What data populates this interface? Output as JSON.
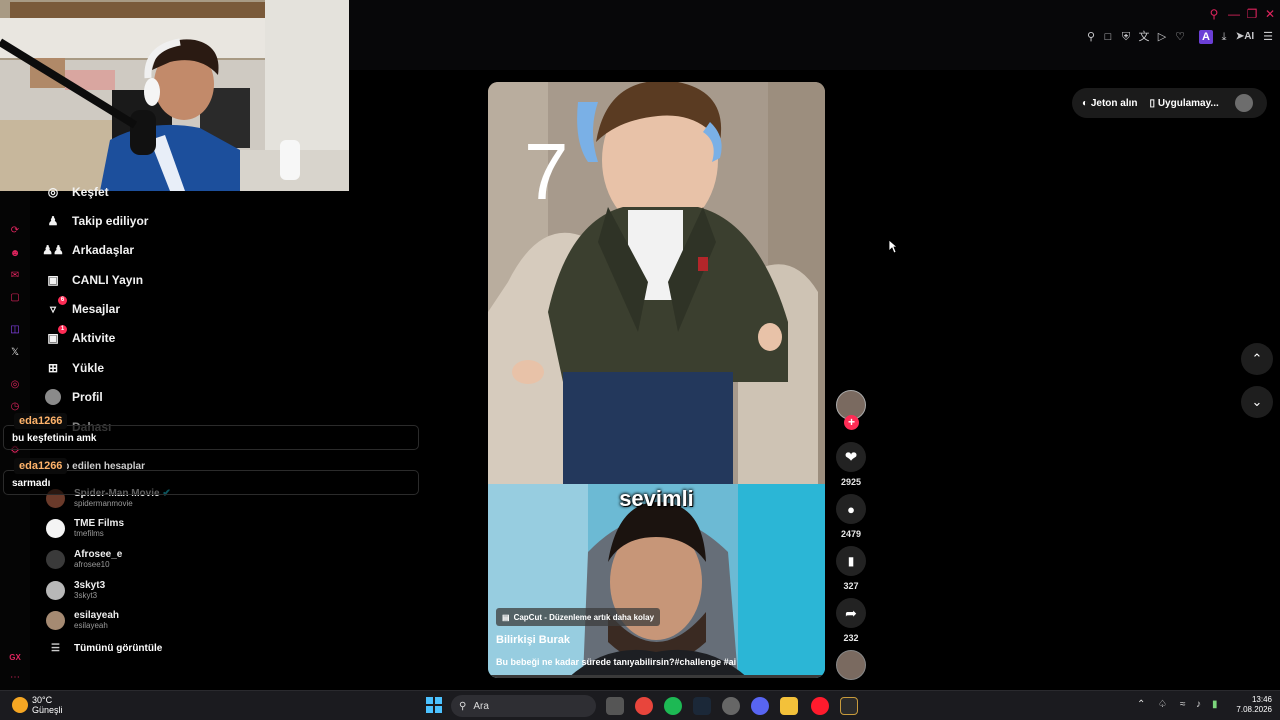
{
  "browser": {
    "toolbar_icons": [
      "pin-icon",
      "snapshot-icon",
      "shield-icon",
      "translate-icon",
      "play-icon",
      "heart-icon",
      "extension-icon",
      "download-icon",
      "ai-icon",
      "menu-icon"
    ],
    "ai_label": "AI"
  },
  "header": {
    "coins_label": "Jeton alın",
    "app_label": "Uygulamay..."
  },
  "sidebar": {
    "items": [
      {
        "label": "Keşfet"
      },
      {
        "label": "Takip ediliyor"
      },
      {
        "label": "Arkadaşlar"
      },
      {
        "label": "CANLI Yayın"
      },
      {
        "label": "Mesajlar",
        "badge": "6"
      },
      {
        "label": "Aktivite",
        "badge": "1"
      },
      {
        "label": "Yükle"
      },
      {
        "label": "Profil"
      },
      {
        "label": "Dahası"
      }
    ],
    "following_header": "Takip edilen hesaplar",
    "accounts": [
      {
        "name": "Spider-Man Movie",
        "handle": "spidermanmovie"
      },
      {
        "name": "TME Films",
        "handle": "tmefilms"
      },
      {
        "name": "Afrosee_e",
        "handle": "afrosee10"
      },
      {
        "name": "3skyt3",
        "handle": "3skyt3"
      },
      {
        "name": "esilayeah",
        "handle": "esilayeah"
      }
    ],
    "see_all": "Tümünü görüntüle"
  },
  "chat": [
    {
      "user": "eda1266",
      "message": "bu keşfetinin amk"
    },
    {
      "user": "eda1266",
      "message": "sarmadı"
    }
  ],
  "video": {
    "overlay_number": "7",
    "caption_word": "sevimli",
    "capcut_label": "CapCut - Düzenleme artık daha kolay",
    "author": "Bilirkişi Burak",
    "description": "Bu bebeği ne kadar sürede tanıyabilirsin?#challenge #ai"
  },
  "actions": {
    "likes": "2925",
    "comments": "2479",
    "saves": "327",
    "shares": "232"
  },
  "taskbar": {
    "weather_temp": "30°C",
    "weather_desc": "Güneşli",
    "search_placeholder": "Ara",
    "time": "13:46",
    "date": "7.08.2026"
  },
  "colors": {
    "accent": "#fe2c55",
    "opera_red": "#e0245e",
    "chat_user": "#ffb36a"
  }
}
